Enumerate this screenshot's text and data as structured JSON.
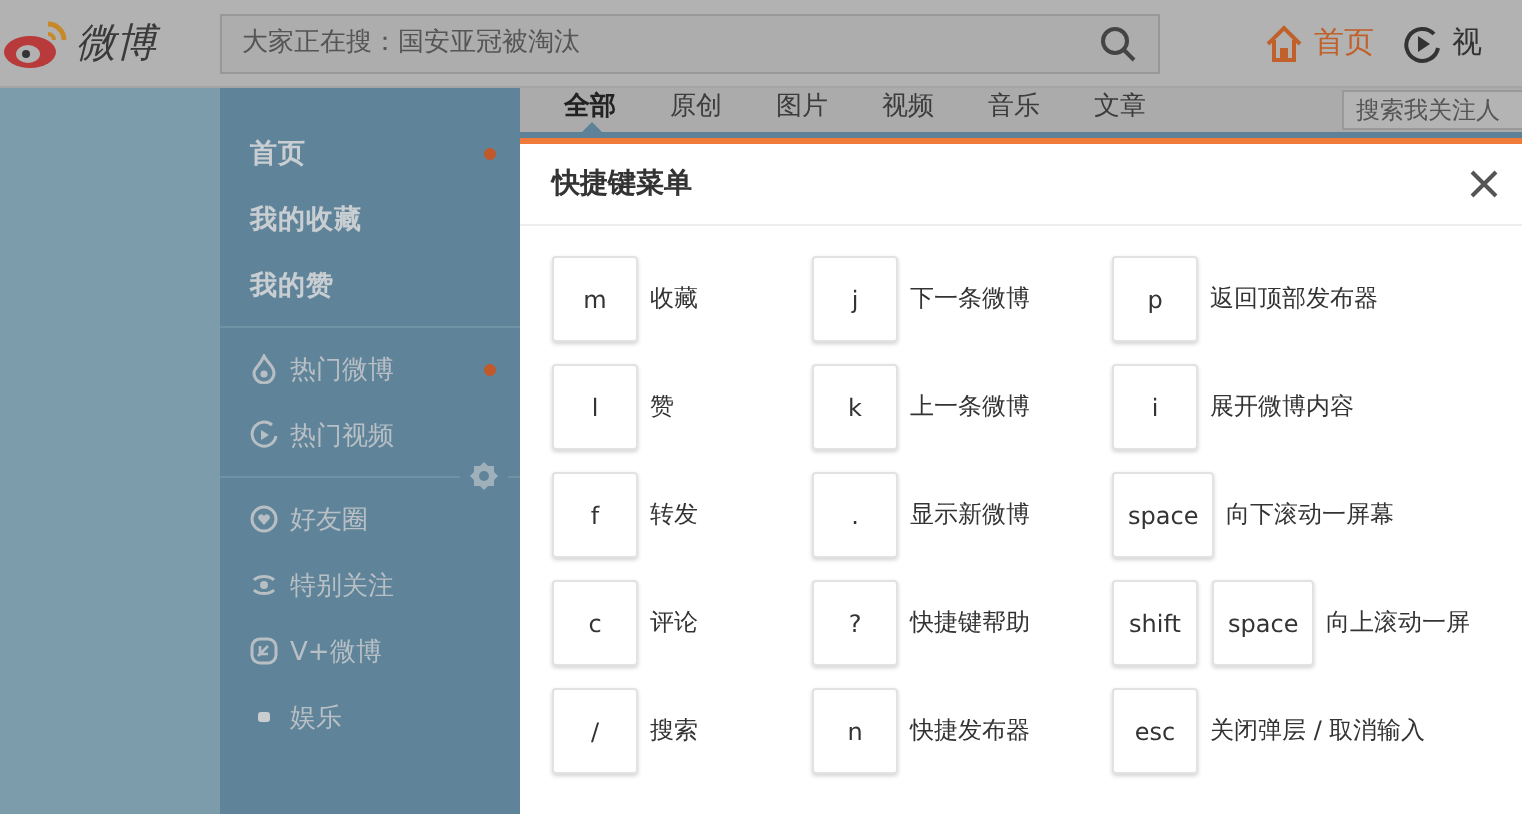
{
  "header": {
    "logo_text": "微博",
    "search": {
      "placeholder": "大家正在搜：国安亚冠被淘汰"
    },
    "nav": [
      {
        "label": "首页",
        "selected": true
      },
      {
        "label": "视",
        "selected": false
      }
    ]
  },
  "sidebar": {
    "sections": [
      {
        "kind": "main",
        "items": [
          {
            "label": "首页",
            "unread": true
          },
          {
            "label": "我的收藏",
            "unread": false
          },
          {
            "label": "我的赞",
            "unread": false
          }
        ]
      },
      {
        "kind": "list",
        "items": [
          {
            "label": "热门微博",
            "unread": true
          },
          {
            "label": "热门视频",
            "unread": false
          }
        ]
      },
      {
        "kind": "list",
        "items": [
          {
            "label": "好友圈",
            "unread": false
          },
          {
            "label": "特别关注",
            "unread": false
          },
          {
            "label": "V+微博",
            "unread": false
          },
          {
            "label": "娱乐",
            "unread": false
          }
        ]
      }
    ]
  },
  "feed_tabs": {
    "tabs": [
      {
        "label": "全部",
        "selected": true
      },
      {
        "label": "原创",
        "selected": false
      },
      {
        "label": "图片",
        "selected": false
      },
      {
        "label": "视频",
        "selected": false
      },
      {
        "label": "音乐",
        "selected": false
      },
      {
        "label": "文章",
        "selected": false
      }
    ],
    "search": {
      "placeholder": "搜索我关注人"
    }
  },
  "dialog": {
    "title": "快捷键菜单",
    "shortcuts": [
      {
        "keys": [
          "m"
        ],
        "label": "收藏"
      },
      {
        "keys": [
          "j"
        ],
        "label": "下一条微博"
      },
      {
        "keys": [
          "p"
        ],
        "label": "返回顶部发布器"
      },
      {
        "keys": [
          "l"
        ],
        "label": "赞"
      },
      {
        "keys": [
          "k"
        ],
        "label": "上一条微博"
      },
      {
        "keys": [
          "i"
        ],
        "label": "展开微博内容"
      },
      {
        "keys": [
          "f"
        ],
        "label": "转发"
      },
      {
        "keys": [
          "."
        ],
        "label": "显示新微博"
      },
      {
        "keys": [
          "space"
        ],
        "label": "向下滚动一屏幕"
      },
      {
        "keys": [
          "c"
        ],
        "label": "评论"
      },
      {
        "keys": [
          "?"
        ],
        "label": "快捷键帮助"
      },
      {
        "keys": [
          "shift",
          "space"
        ],
        "label": "向上滚动一屏"
      },
      {
        "keys": [
          "/"
        ],
        "label": "搜索"
      },
      {
        "keys": [
          "n"
        ],
        "label": "快捷发布器"
      },
      {
        "keys": [
          "esc"
        ],
        "label": "关闭弹层 / 取消输入"
      }
    ]
  }
}
